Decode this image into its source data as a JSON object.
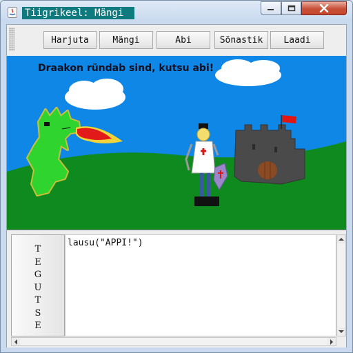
{
  "window": {
    "title": "Tiigrikeel: Mängi",
    "controls": [
      {
        "name": "minimize",
        "icon": "minimize-icon"
      },
      {
        "name": "maximize",
        "icon": "maximize-icon"
      },
      {
        "name": "close",
        "icon": "close-icon"
      }
    ]
  },
  "toolbar": {
    "buttons": [
      {
        "label": "Harjuta"
      },
      {
        "label": "Mängi"
      },
      {
        "label": "Abi"
      },
      {
        "label": "Sõnastik"
      },
      {
        "label": "Laadi"
      }
    ]
  },
  "scene": {
    "message": "Draakon ründab sind, kutsu abi!",
    "colors": {
      "sky": "#0e87e6",
      "grass": "#0f8a1e",
      "dragon": "#2fd42f",
      "fire": "#e21a1a",
      "castle": "#4a4a4a",
      "flag": "#e01616"
    }
  },
  "action": {
    "letters": [
      "T",
      "E",
      "G",
      "U",
      "T",
      "S",
      "E"
    ]
  },
  "editor": {
    "code": "lausu(\"APPI!\")"
  }
}
